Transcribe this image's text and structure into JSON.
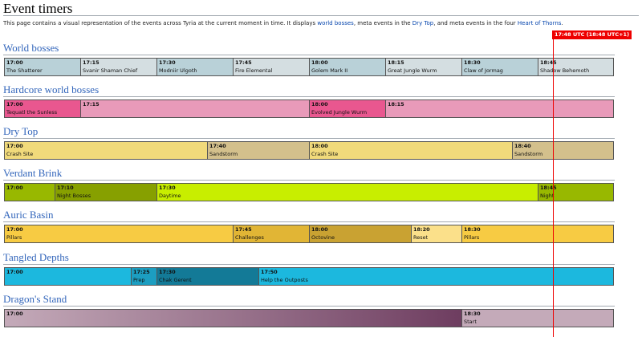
{
  "page": {
    "title": "Event timers",
    "intro": {
      "before": "This page contains a visual representation of the events across Tyria at the current moment in time. It displays ",
      "link1": "world bosses",
      "mid1": ", meta events in the ",
      "link2": "Dry Top",
      "mid2": ", and meta events in the four ",
      "link3": "Heart of Thorns",
      "after": "."
    },
    "now_label": "17:48 UTC (18:48 UTC+1)",
    "now_fraction": 0.9
  },
  "sections": [
    {
      "title": "World bosses",
      "segments": [
        {
          "time": "17:00",
          "name": "The Shatterer",
          "color": "#b9d1d8"
        },
        {
          "time": "17:15",
          "name": "Svanir Shaman Chief",
          "color": "#d4dee1"
        },
        {
          "time": "17:30",
          "name": "Modniir Ulgoth",
          "color": "#b9d1d8"
        },
        {
          "time": "17:45",
          "name": "Fire Elemental",
          "color": "#d4dee1"
        },
        {
          "time": "18:00",
          "name": "Golem Mark II",
          "color": "#b9d1d8"
        },
        {
          "time": "18:15",
          "name": "Great Jungle Wurm",
          "color": "#d4dee1"
        },
        {
          "time": "18:30",
          "name": "Claw of Jormag",
          "color": "#b9d1d8"
        },
        {
          "time": "18:45",
          "name": "Shadow Behemoth",
          "color": "#d4dee1"
        }
      ]
    },
    {
      "title": "Hardcore world bosses",
      "segments": [
        {
          "time": "17:00",
          "name": "Tequatl the Sunless",
          "color": "#e9578f"
        },
        {
          "time": "17:15",
          "name": "",
          "color": "#e89ab9"
        },
        {
          "time": "18:00",
          "name": "Evolved Jungle Wurm",
          "color": "#e9578f"
        },
        {
          "time": "18:15",
          "name": "",
          "color": "#e89ab9"
        }
      ]
    },
    {
      "title": "Dry Top",
      "segments": [
        {
          "time": "17:00",
          "name": "Crash Site",
          "color": "#f1da7b"
        },
        {
          "time": "17:40",
          "name": "Sandstorm",
          "color": "#d3c08c"
        },
        {
          "time": "18:00",
          "name": "Crash Site",
          "color": "#f1da7b"
        },
        {
          "time": "18:40",
          "name": "Sandstorm",
          "color": "#d3c08c"
        }
      ]
    },
    {
      "title": "Verdant Brink",
      "segments": [
        {
          "time": "17:00",
          "name": "",
          "color": "#98b800"
        },
        {
          "time": "17:10",
          "name": "Night Bosses",
          "color": "#87a000"
        },
        {
          "time": "17:30",
          "name": "Daytime",
          "color": "#c8ee00"
        },
        {
          "time": "18:45",
          "name": "Night",
          "color": "#98b800"
        }
      ]
    },
    {
      "title": "Auric Basin",
      "segments": [
        {
          "time": "17:00",
          "name": "Pillars",
          "color": "#f7cb43"
        },
        {
          "time": "17:45",
          "name": "Challenges",
          "color": "#e1b535"
        },
        {
          "time": "18:00",
          "name": "Octovine",
          "color": "#c9a232"
        },
        {
          "time": "18:20",
          "name": "Reset",
          "color": "#fbe08a"
        },
        {
          "time": "18:30",
          "name": "Pillars",
          "color": "#f7cb43"
        }
      ]
    },
    {
      "title": "Tangled Depths",
      "segments": [
        {
          "time": "17:00",
          "name": "",
          "color": "#1cb8de"
        },
        {
          "time": "17:25",
          "name": "Prep",
          "color": "#1c9ec1"
        },
        {
          "time": "17:30",
          "name": "Chak Gerent",
          "color": "#137a97"
        },
        {
          "time": "17:50",
          "name": "Help the Outposts",
          "color": "#1cb8de"
        }
      ]
    },
    {
      "title": "Dragon's Stand",
      "segments": [
        {
          "time": "17:00",
          "name": "",
          "color": "#c4aab9",
          "color_to": "#6e3d60"
        },
        {
          "time": "18:30",
          "name": "Start",
          "color": "#c4aab9"
        }
      ]
    }
  ]
}
